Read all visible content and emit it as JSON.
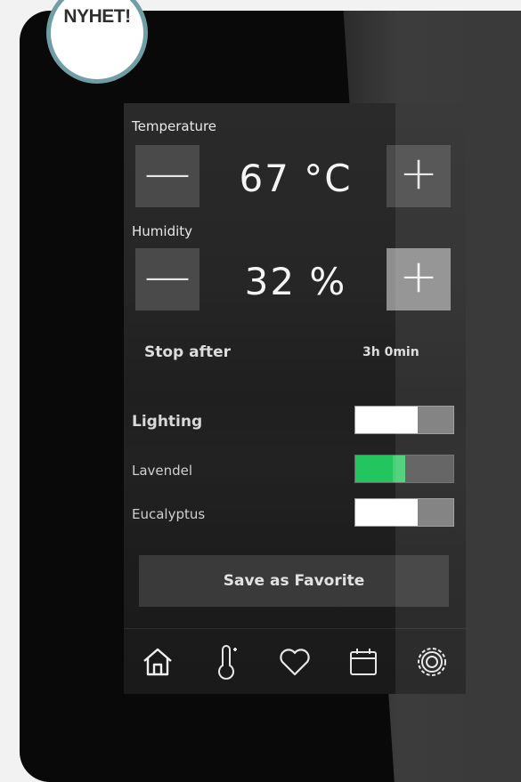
{
  "badge": {
    "text": "NYHET!"
  },
  "temperature": {
    "label": "Temperature",
    "value": "67 °C",
    "minus": "—",
    "plus": "+"
  },
  "humidity": {
    "label": "Humidity",
    "value": "32 %",
    "minus": "—",
    "plus": "+"
  },
  "timer": {
    "label": "Stop after",
    "value": "3h 0min"
  },
  "toggles": [
    {
      "label": "Lighting",
      "state": "off"
    },
    {
      "label": "Lavendel",
      "state": "on"
    },
    {
      "label": "Eucalyptus",
      "state": "off"
    }
  ],
  "favorite_button": {
    "label": "Save as Favorite"
  },
  "nav": [
    {
      "icon": "home-icon"
    },
    {
      "icon": "thermometer-icon"
    },
    {
      "icon": "heart-icon"
    },
    {
      "icon": "calendar-icon"
    },
    {
      "icon": "gear-icon"
    }
  ],
  "colors": {
    "accent": "#22c55e",
    "badge_ring": "#6f9ea4"
  }
}
